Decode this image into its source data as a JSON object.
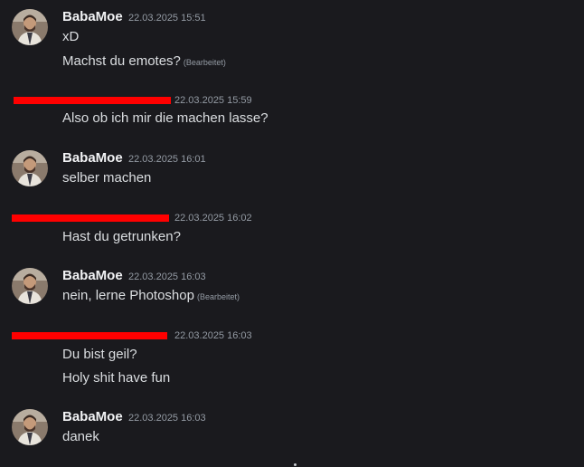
{
  "messages": [
    {
      "author": "BabaMoe",
      "time": "22.03.2025 15:51",
      "lines": [
        {
          "text": "xD",
          "edited": ""
        },
        {
          "text": "Machst du emotes?",
          "edited": "(Bearbeitet)"
        }
      ]
    },
    {
      "author": "",
      "time": "22.03.2025 15:59",
      "lines": [
        {
          "text": "Also ob ich mir die machen lasse?",
          "edited": ""
        }
      ]
    },
    {
      "author": "BabaMoe",
      "time": "22.03.2025 16:01",
      "lines": [
        {
          "text": "selber machen",
          "edited": ""
        }
      ]
    },
    {
      "author": "",
      "time": "22.03.2025 16:02",
      "lines": [
        {
          "text": "Hast du getrunken?",
          "edited": ""
        }
      ]
    },
    {
      "author": "BabaMoe",
      "time": "22.03.2025 16:03",
      "lines": [
        {
          "text": "nein, lerne Photoshop",
          "edited": "(Bearbeitet)"
        }
      ]
    },
    {
      "author": "",
      "time": "22.03.2025 16:03",
      "lines": [
        {
          "text": "Du bist geil?",
          "edited": ""
        },
        {
          "text": "Holy shit have fun",
          "edited": ""
        }
      ]
    },
    {
      "author": "BabaMoe",
      "time": "22.03.2025 16:03",
      "lines": [
        {
          "text": "danek",
          "edited": ""
        }
      ]
    }
  ],
  "colors": {
    "background": "#1a1a1e",
    "username": "#f2f3f5",
    "message_text": "#dbdee1",
    "timestamp": "#949ba4",
    "redaction": "#ff0000"
  },
  "icons": {
    "avatar": "profile-photo-avatar-icon"
  }
}
